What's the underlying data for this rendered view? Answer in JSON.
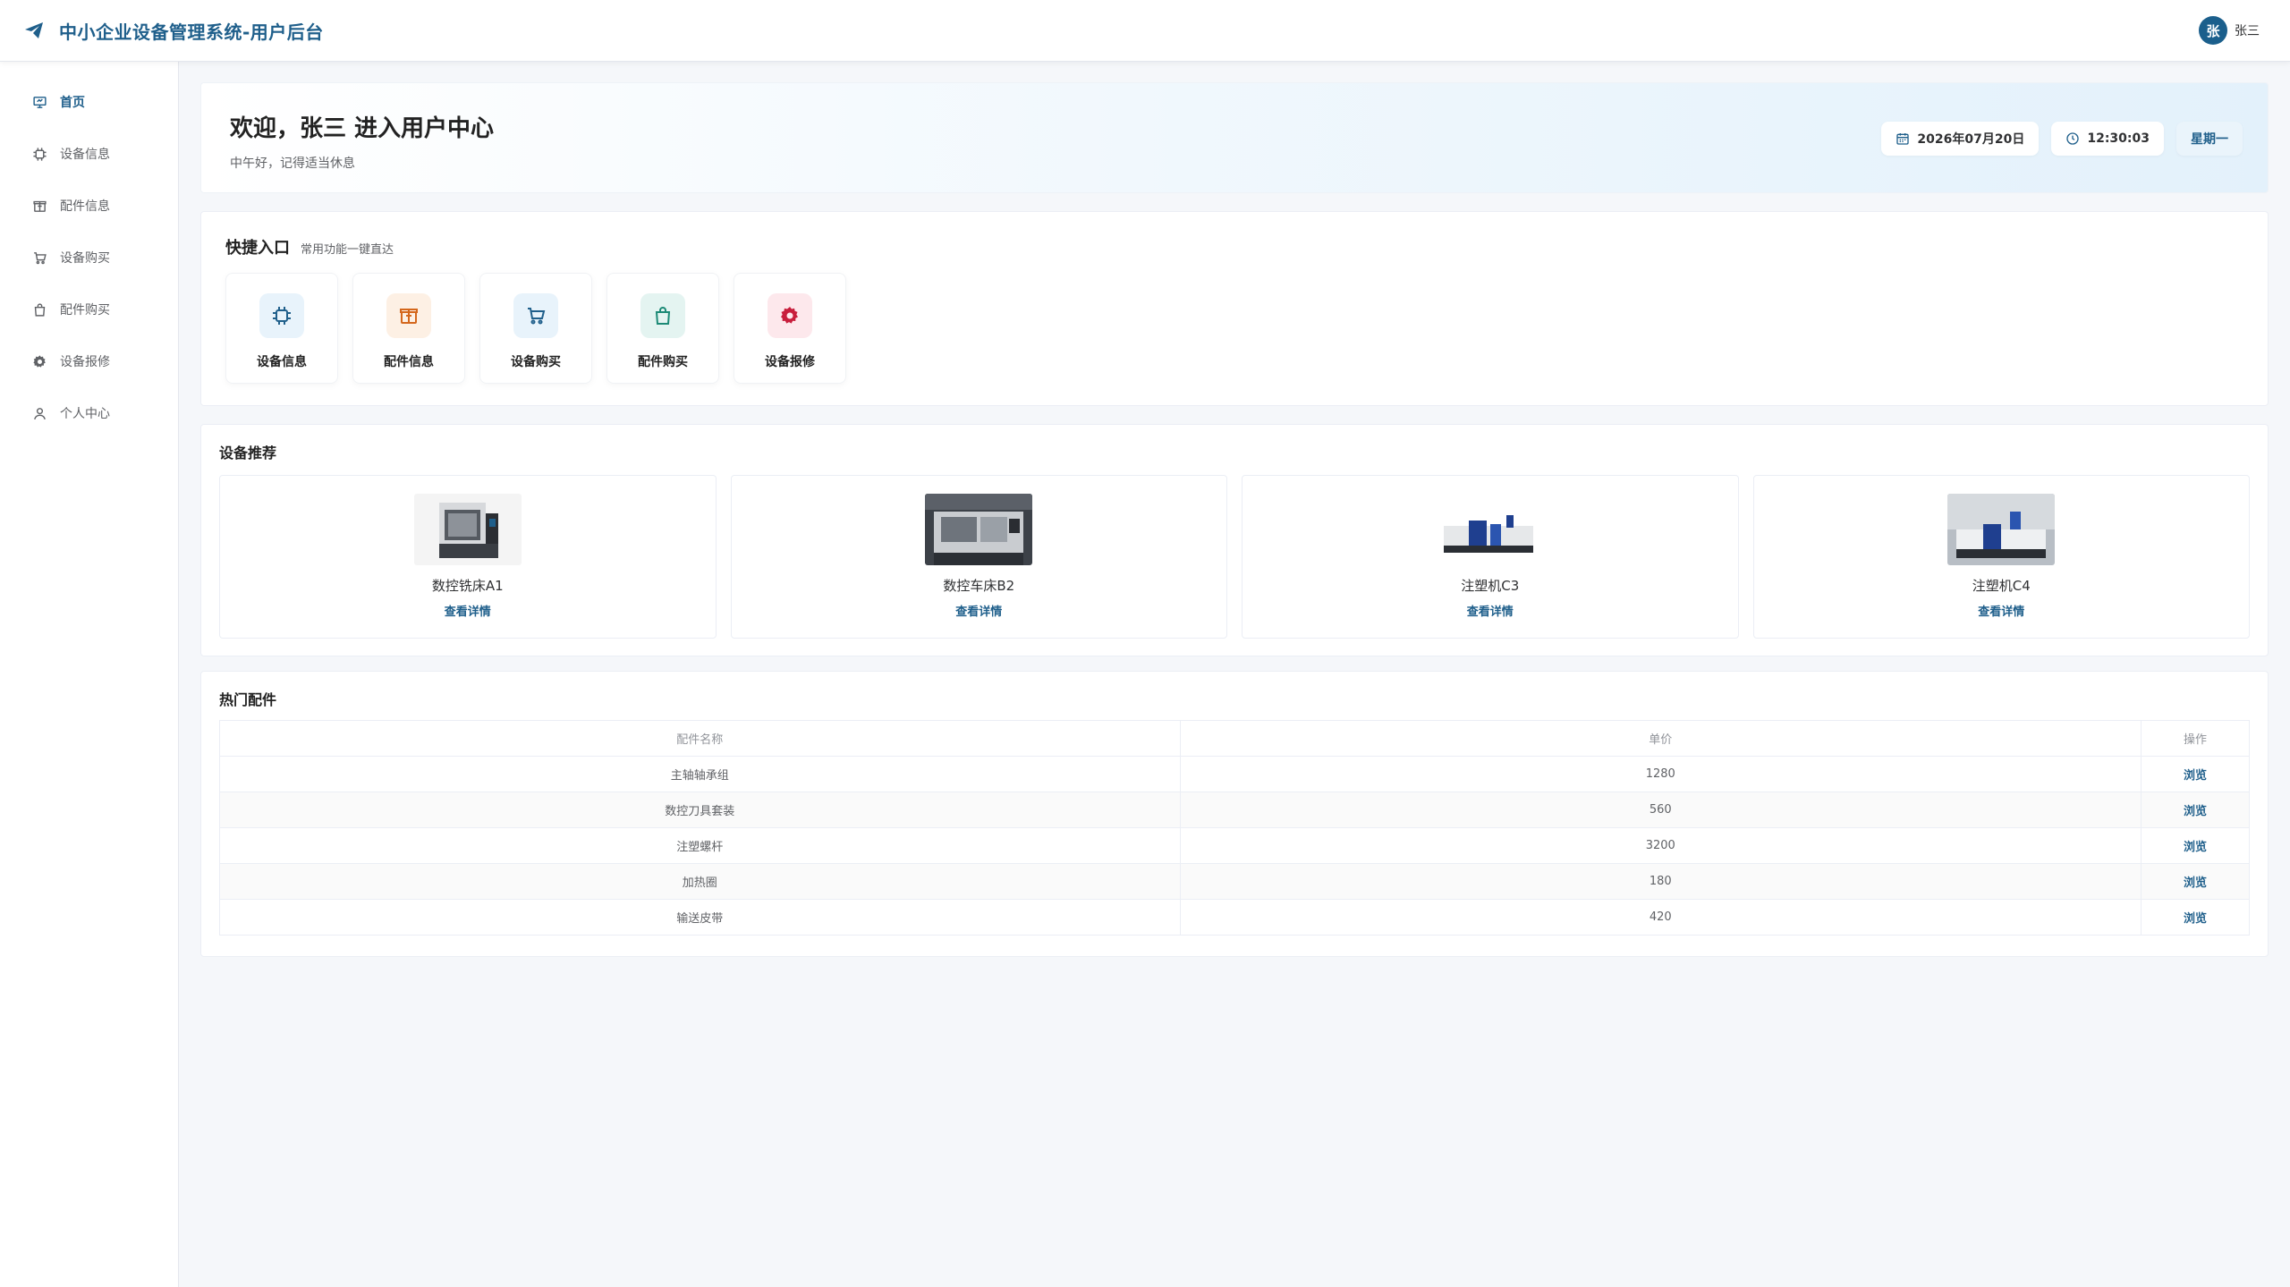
{
  "header": {
    "title": "中小企业设备管理系统-用户后台",
    "user": {
      "avatar_text": "张",
      "name": "张三"
    }
  },
  "sidebar": {
    "items": [
      {
        "label": "首页",
        "icon": "monitor-icon",
        "active": true
      },
      {
        "label": "设备信息",
        "icon": "cpu-icon",
        "active": false
      },
      {
        "label": "配件信息",
        "icon": "box-icon",
        "active": false
      },
      {
        "label": "设备购买",
        "icon": "cart-icon",
        "active": false
      },
      {
        "label": "配件购买",
        "icon": "bag-icon",
        "active": false
      },
      {
        "label": "设备报修",
        "icon": "gear-icon",
        "active": false
      },
      {
        "label": "个人中心",
        "icon": "user-icon",
        "active": false
      }
    ]
  },
  "welcome": {
    "title": "欢迎，张三 进入用户中心",
    "subtitle": "中午好，记得适当休息",
    "date": "2026年07月20日",
    "time": "12:30:03",
    "weekday": "星期一"
  },
  "quick": {
    "title": "快捷入口",
    "desc": "常用功能一键直达",
    "items": [
      {
        "label": "设备信息",
        "icon": "cpu-icon",
        "bg": "#e8f3fb",
        "color": "#1f5f8b"
      },
      {
        "label": "配件信息",
        "icon": "box-icon",
        "bg": "#fdf0e4",
        "color": "#d4671c"
      },
      {
        "label": "设备购买",
        "icon": "cart-icon",
        "bg": "#e8f3fb",
        "color": "#1f5f8b"
      },
      {
        "label": "配件购买",
        "icon": "bag-icon",
        "bg": "#e4f4f1",
        "color": "#1c8a76"
      },
      {
        "label": "设备报修",
        "icon": "gear-icon",
        "bg": "#fde8ec",
        "color": "#c81e3c"
      }
    ]
  },
  "recommend": {
    "title": "设备推荐",
    "link_label": "查看详情",
    "devices": [
      {
        "name": "数控铣床A1"
      },
      {
        "name": "数控车床B2"
      },
      {
        "name": "注塑机C3"
      },
      {
        "name": "注塑机C4"
      }
    ]
  },
  "parts": {
    "title": "热门配件",
    "columns": [
      "配件名称",
      "单价",
      "操作"
    ],
    "op_label": "浏览",
    "rows": [
      {
        "name": "主轴轴承组",
        "price": "1280"
      },
      {
        "name": "数控刀具套装",
        "price": "560"
      },
      {
        "name": "注塑螺杆",
        "price": "3200"
      },
      {
        "name": "加热圈",
        "price": "180"
      },
      {
        "name": "输送皮带",
        "price": "420"
      }
    ]
  },
  "colors": {
    "primary": "#1f5f8b",
    "sidebar_active": "#1f5f8b",
    "link": "#1f5f8b"
  }
}
